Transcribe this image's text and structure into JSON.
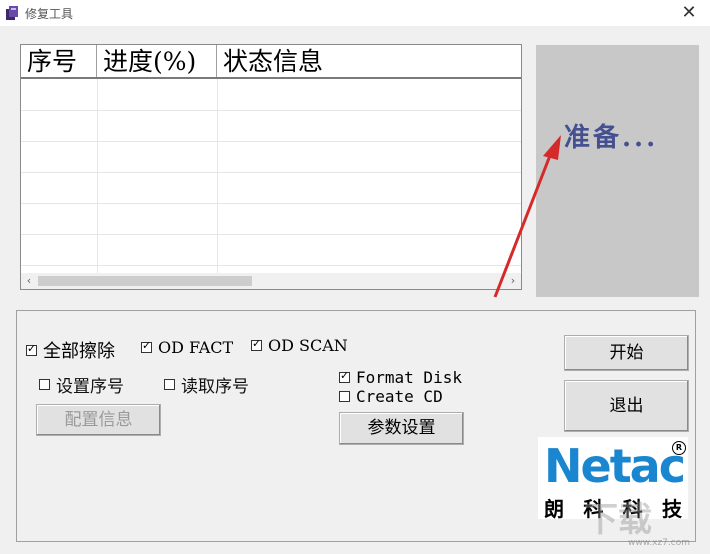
{
  "window": {
    "title": "修复工具",
    "close_glyph": "✕"
  },
  "list": {
    "columns": [
      "序号",
      "进度(%)",
      "状态信息"
    ],
    "rows": []
  },
  "status": {
    "text": "准备..."
  },
  "options": {
    "erase_all": {
      "label": "全部擦除",
      "checked": true
    },
    "od_fact": {
      "label": "OD FACT",
      "checked": true
    },
    "od_scan": {
      "label": "OD SCAN",
      "checked": true
    },
    "set_serial": {
      "label": "设置序号",
      "checked": false
    },
    "read_serial": {
      "label": "读取序号",
      "checked": false
    },
    "format_disk": {
      "label": "Format Disk",
      "checked": true
    },
    "create_cd": {
      "label": "Create CD",
      "checked": false
    }
  },
  "buttons": {
    "config_info": "配置信息",
    "param_settings": "参数设置",
    "start": "开始",
    "exit": "退出"
  },
  "logo": {
    "wordmark": "Netac",
    "registered": "R",
    "chinese": [
      "朗",
      "科",
      "科",
      "技"
    ]
  },
  "watermark": {
    "text": "下载",
    "url": "www.xz7.com"
  },
  "colors": {
    "status_text": "#44508f",
    "logo_blue": "#1a86d0",
    "annotation_arrow": "#d42a2a"
  },
  "icons": {
    "app": "app-icon",
    "close": "close-icon",
    "scroll_left": "chevron-left-icon",
    "scroll_right": "chevron-right-icon"
  }
}
